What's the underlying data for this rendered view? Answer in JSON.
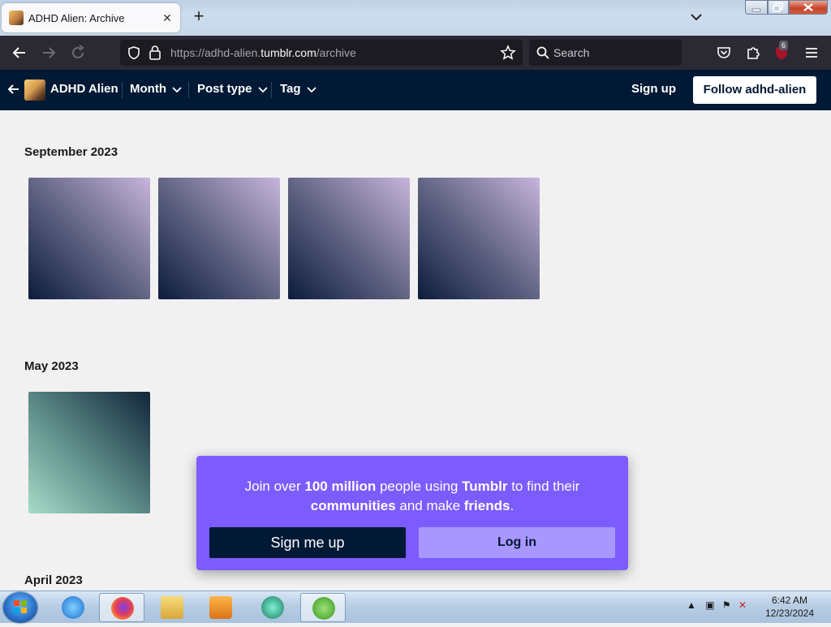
{
  "browser": {
    "tab_title": "ADHD Alien: Archive",
    "close_glyph": "✕",
    "new_tab_glyph": "+",
    "url_prefix": "https://adhd-alien.",
    "url_host": "tumblr.com",
    "url_path": "/archive",
    "search_placeholder": "Search",
    "extension_badge": "6"
  },
  "tumblr": {
    "blog_name": "ADHD Alien",
    "filters": [
      "Month",
      "Post type",
      "Tag"
    ],
    "sign_up": "Sign up",
    "follow": "Follow adhd-alien"
  },
  "archive": {
    "months": [
      {
        "label": "September 2023",
        "posts": 4
      },
      {
        "label": "May 2023",
        "posts": 1
      },
      {
        "label": "April 2023",
        "posts": 0
      }
    ]
  },
  "popup": {
    "t1": "Join over ",
    "b1": "100 million",
    "t2": " people using ",
    "b2": "Tumblr",
    "t3": " to find their ",
    "b3": "communities",
    "t4": " and make ",
    "b4": "friends",
    "t5": ".",
    "signup_button": "Sign me up",
    "login_button": "Log in"
  },
  "taskbar": {
    "time": "6:42 AM",
    "date": "12/23/2024"
  },
  "colors": {
    "tumblr_navy": "#001935",
    "popup_purple": "#7c5cff",
    "login_lilac": "#a897ff"
  }
}
